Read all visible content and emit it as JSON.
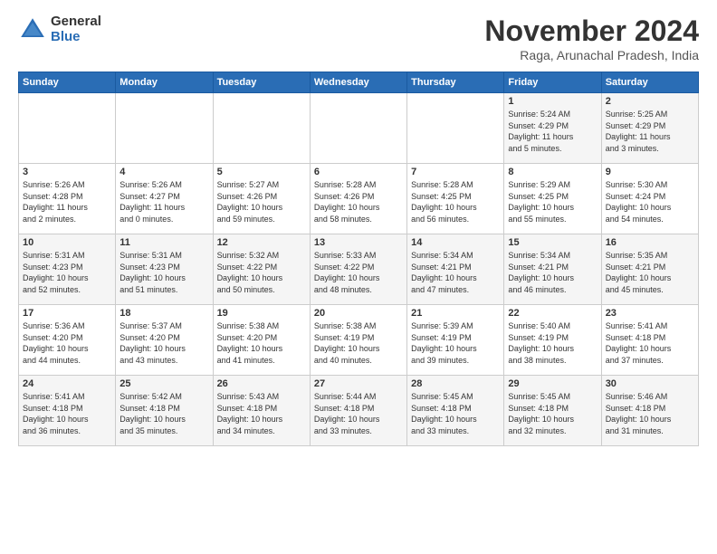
{
  "logo": {
    "general": "General",
    "blue": "Blue"
  },
  "title": {
    "month": "November 2024",
    "location": "Raga, Arunachal Pradesh, India"
  },
  "days_header": [
    "Sunday",
    "Monday",
    "Tuesday",
    "Wednesday",
    "Thursday",
    "Friday",
    "Saturday"
  ],
  "weeks": [
    [
      {
        "num": "",
        "info": ""
      },
      {
        "num": "",
        "info": ""
      },
      {
        "num": "",
        "info": ""
      },
      {
        "num": "",
        "info": ""
      },
      {
        "num": "",
        "info": ""
      },
      {
        "num": "1",
        "info": "Sunrise: 5:24 AM\nSunset: 4:29 PM\nDaylight: 11 hours\nand 5 minutes."
      },
      {
        "num": "2",
        "info": "Sunrise: 5:25 AM\nSunset: 4:29 PM\nDaylight: 11 hours\nand 3 minutes."
      }
    ],
    [
      {
        "num": "3",
        "info": "Sunrise: 5:26 AM\nSunset: 4:28 PM\nDaylight: 11 hours\nand 2 minutes."
      },
      {
        "num": "4",
        "info": "Sunrise: 5:26 AM\nSunset: 4:27 PM\nDaylight: 11 hours\nand 0 minutes."
      },
      {
        "num": "5",
        "info": "Sunrise: 5:27 AM\nSunset: 4:26 PM\nDaylight: 10 hours\nand 59 minutes."
      },
      {
        "num": "6",
        "info": "Sunrise: 5:28 AM\nSunset: 4:26 PM\nDaylight: 10 hours\nand 58 minutes."
      },
      {
        "num": "7",
        "info": "Sunrise: 5:28 AM\nSunset: 4:25 PM\nDaylight: 10 hours\nand 56 minutes."
      },
      {
        "num": "8",
        "info": "Sunrise: 5:29 AM\nSunset: 4:25 PM\nDaylight: 10 hours\nand 55 minutes."
      },
      {
        "num": "9",
        "info": "Sunrise: 5:30 AM\nSunset: 4:24 PM\nDaylight: 10 hours\nand 54 minutes."
      }
    ],
    [
      {
        "num": "10",
        "info": "Sunrise: 5:31 AM\nSunset: 4:23 PM\nDaylight: 10 hours\nand 52 minutes."
      },
      {
        "num": "11",
        "info": "Sunrise: 5:31 AM\nSunset: 4:23 PM\nDaylight: 10 hours\nand 51 minutes."
      },
      {
        "num": "12",
        "info": "Sunrise: 5:32 AM\nSunset: 4:22 PM\nDaylight: 10 hours\nand 50 minutes."
      },
      {
        "num": "13",
        "info": "Sunrise: 5:33 AM\nSunset: 4:22 PM\nDaylight: 10 hours\nand 48 minutes."
      },
      {
        "num": "14",
        "info": "Sunrise: 5:34 AM\nSunset: 4:21 PM\nDaylight: 10 hours\nand 47 minutes."
      },
      {
        "num": "15",
        "info": "Sunrise: 5:34 AM\nSunset: 4:21 PM\nDaylight: 10 hours\nand 46 minutes."
      },
      {
        "num": "16",
        "info": "Sunrise: 5:35 AM\nSunset: 4:21 PM\nDaylight: 10 hours\nand 45 minutes."
      }
    ],
    [
      {
        "num": "17",
        "info": "Sunrise: 5:36 AM\nSunset: 4:20 PM\nDaylight: 10 hours\nand 44 minutes."
      },
      {
        "num": "18",
        "info": "Sunrise: 5:37 AM\nSunset: 4:20 PM\nDaylight: 10 hours\nand 43 minutes."
      },
      {
        "num": "19",
        "info": "Sunrise: 5:38 AM\nSunset: 4:20 PM\nDaylight: 10 hours\nand 41 minutes."
      },
      {
        "num": "20",
        "info": "Sunrise: 5:38 AM\nSunset: 4:19 PM\nDaylight: 10 hours\nand 40 minutes."
      },
      {
        "num": "21",
        "info": "Sunrise: 5:39 AM\nSunset: 4:19 PM\nDaylight: 10 hours\nand 39 minutes."
      },
      {
        "num": "22",
        "info": "Sunrise: 5:40 AM\nSunset: 4:19 PM\nDaylight: 10 hours\nand 38 minutes."
      },
      {
        "num": "23",
        "info": "Sunrise: 5:41 AM\nSunset: 4:18 PM\nDaylight: 10 hours\nand 37 minutes."
      }
    ],
    [
      {
        "num": "24",
        "info": "Sunrise: 5:41 AM\nSunset: 4:18 PM\nDaylight: 10 hours\nand 36 minutes."
      },
      {
        "num": "25",
        "info": "Sunrise: 5:42 AM\nSunset: 4:18 PM\nDaylight: 10 hours\nand 35 minutes."
      },
      {
        "num": "26",
        "info": "Sunrise: 5:43 AM\nSunset: 4:18 PM\nDaylight: 10 hours\nand 34 minutes."
      },
      {
        "num": "27",
        "info": "Sunrise: 5:44 AM\nSunset: 4:18 PM\nDaylight: 10 hours\nand 33 minutes."
      },
      {
        "num": "28",
        "info": "Sunrise: 5:45 AM\nSunset: 4:18 PM\nDaylight: 10 hours\nand 33 minutes."
      },
      {
        "num": "29",
        "info": "Sunrise: 5:45 AM\nSunset: 4:18 PM\nDaylight: 10 hours\nand 32 minutes."
      },
      {
        "num": "30",
        "info": "Sunrise: 5:46 AM\nSunset: 4:18 PM\nDaylight: 10 hours\nand 31 minutes."
      }
    ]
  ]
}
